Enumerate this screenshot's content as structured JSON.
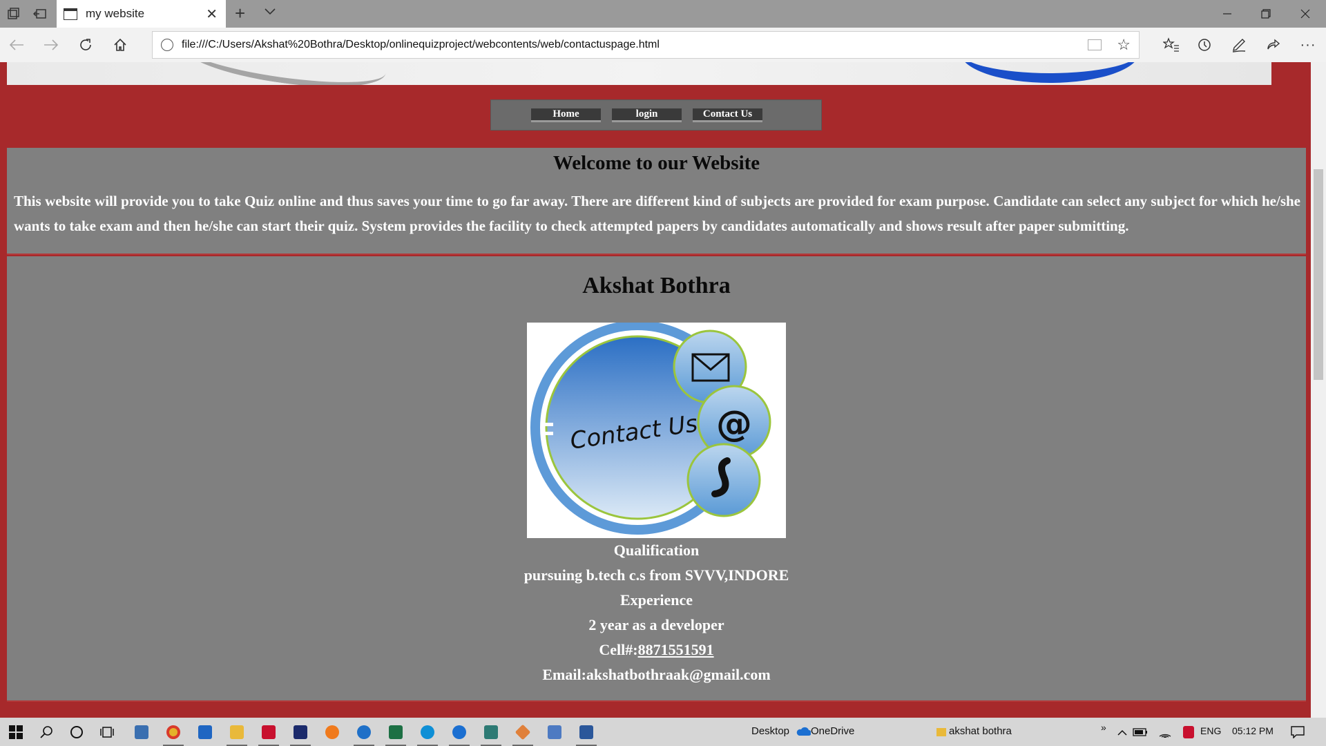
{
  "browser": {
    "tab_title": "my website",
    "url": "file:///C:/Users/Akshat%20Bothra/Desktop/onlinequizproject/webcontents/web/contactuspage.html"
  },
  "menu": {
    "items": [
      {
        "label": "Home"
      },
      {
        "label": "login"
      },
      {
        "label": "Contact Us"
      }
    ]
  },
  "welcome": {
    "heading": "Welcome to our Website",
    "text": "This website will provide you to take Quiz online and thus saves your time to go far away. There are different kind of subjects are provided for exam purpose. Candidate can select any subject for which he/she wants to take exam and then he/she can start their quiz. System provides the facility to check attempted papers by candidates automatically and shows result after paper submitting."
  },
  "contact": {
    "name": "Akshat Bothra",
    "image_text": "Contact Us",
    "qualification_label": "Qualification",
    "qualification": "pursuing b.tech c.s from SVVV,INDORE",
    "experience_label": "Experience",
    "experience": "2 year as a developer",
    "cell_label": "Cell#:",
    "cell": "8871551591",
    "email": "Email:akshatbothraak@gmail.com"
  },
  "taskbar": {
    "desktop_label": "Desktop",
    "onedrive_label": "OneDrive",
    "user_label": "akshat bothra",
    "language": "ENG",
    "time": "05:12 PM"
  },
  "colors": {
    "page_background": "#a7292b",
    "panel": "#808080",
    "menu": "#6b6b6b"
  }
}
